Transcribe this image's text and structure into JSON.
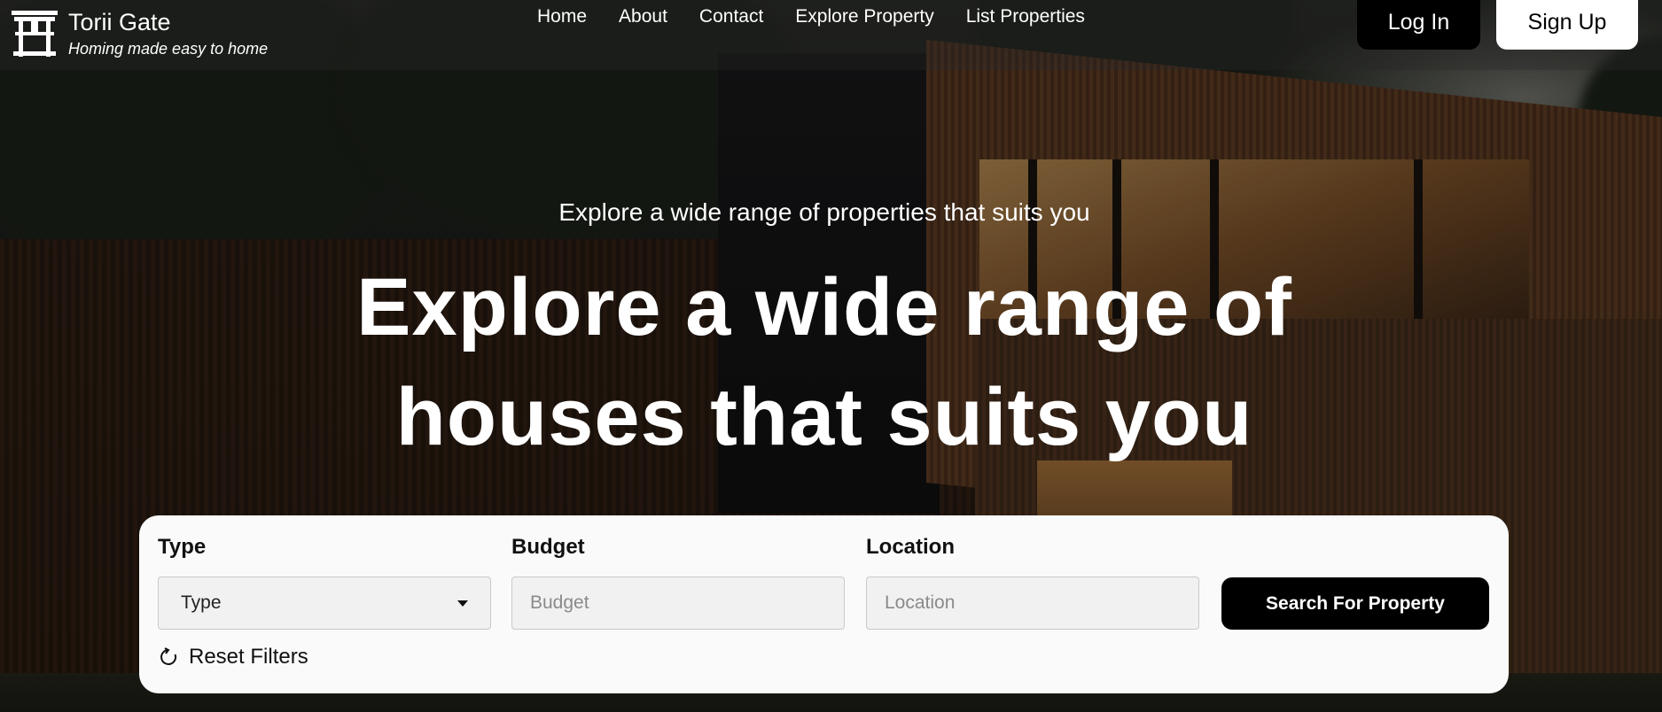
{
  "brand": {
    "name": "Torii Gate",
    "tagline": "Homing made easy to home"
  },
  "nav": {
    "items": [
      {
        "label": "Home"
      },
      {
        "label": "About"
      },
      {
        "label": "Contact"
      },
      {
        "label": "Explore Property"
      },
      {
        "label": "List Properties"
      }
    ]
  },
  "auth": {
    "login_label": "Log In",
    "signup_label": "Sign Up"
  },
  "hero": {
    "subheading": "Explore a wide range of properties that suits you",
    "headline": "Explore a wide range of houses that suits you"
  },
  "search": {
    "type": {
      "label": "Type",
      "selected": "Type"
    },
    "budget": {
      "label": "Budget",
      "placeholder": "Budget",
      "value": ""
    },
    "location": {
      "label": "Location",
      "placeholder": "Location",
      "value": ""
    },
    "submit_label": "Search For Property",
    "reset_label": "Reset Filters"
  },
  "icons": {
    "logo": "torii-gate-icon",
    "dropdown": "caret-down-icon",
    "reset": "refresh-icon"
  },
  "colors": {
    "primary_button": "#000000",
    "card_background": "#fafafa",
    "text_light": "#ffffff"
  }
}
